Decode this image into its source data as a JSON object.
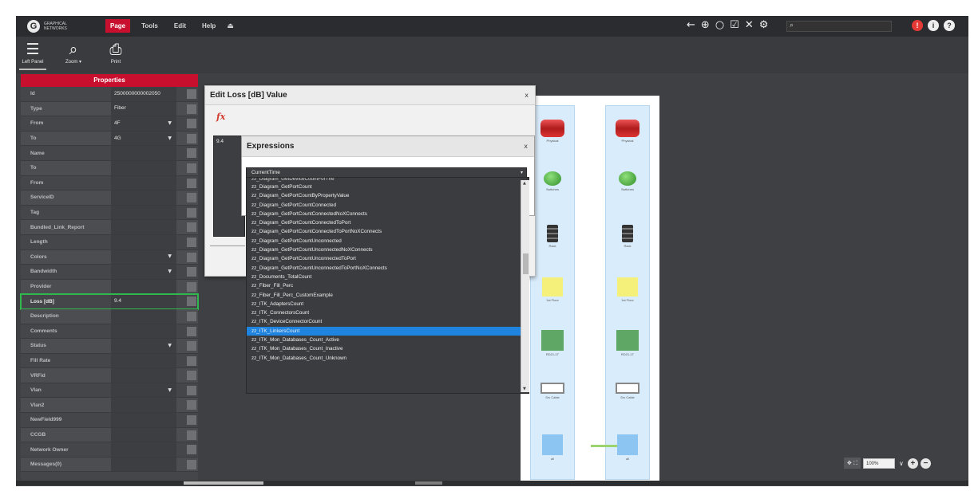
{
  "menubar": {
    "logo_text": "GRAPHICAL NETWORKS",
    "menus": [
      "Page",
      "Tools",
      "Edit",
      "Help"
    ],
    "tool_icons": [
      "back-arrow",
      "globe",
      "circle",
      "checkbox",
      "tools",
      "gear"
    ],
    "search_placeholder": ""
  },
  "ribbon": {
    "buttons": [
      {
        "label": "Left Panel",
        "icon": "left-panel"
      },
      {
        "label": "Zoom ▾",
        "icon": "magnifier"
      },
      {
        "label": "Print",
        "icon": "printer"
      }
    ]
  },
  "properties": {
    "title": "Properties",
    "rows": [
      {
        "name": "Id",
        "value": "2500000000002050"
      },
      {
        "name": "Type",
        "value": "Fiber"
      },
      {
        "name": "From",
        "value": "4F",
        "dropdown": true
      },
      {
        "name": "To",
        "value": "4G",
        "dropdown": true
      },
      {
        "name": "Name",
        "value": ""
      },
      {
        "name": "To",
        "value": ""
      },
      {
        "name": "From",
        "value": ""
      },
      {
        "name": "ServiceID",
        "value": ""
      },
      {
        "name": "Tag",
        "value": ""
      },
      {
        "name": "Bundled_Link_Report",
        "value": ""
      },
      {
        "name": "Length",
        "value": ""
      },
      {
        "name": "Colors",
        "value": "",
        "dropdown": true
      },
      {
        "name": "Bandwidth",
        "value": "",
        "dropdown": true
      },
      {
        "name": "Provider",
        "value": ""
      },
      {
        "name": "Loss [dB]",
        "value": "9.4",
        "highlight": true
      },
      {
        "name": "Description",
        "value": ""
      },
      {
        "name": "Comments",
        "value": ""
      },
      {
        "name": "Status",
        "value": "",
        "dropdown": true
      },
      {
        "name": "Fill Rate",
        "value": ""
      },
      {
        "name": "VRFid",
        "value": ""
      },
      {
        "name": "Vlan",
        "value": "",
        "dropdown": true
      },
      {
        "name": "Vlan2",
        "value": ""
      },
      {
        "name": "NewField999",
        "value": ""
      },
      {
        "name": "CCGB",
        "value": ""
      },
      {
        "name": "Network Owner",
        "value": ""
      },
      {
        "name": "Messages(0)",
        "value": ""
      }
    ]
  },
  "loss_dialog": {
    "title": "Edit Loss [dB] Value",
    "close": "x",
    "fx": "fx",
    "value": "9.4"
  },
  "expressions_dialog": {
    "title": "Expressions",
    "close": "x",
    "selected": "CurrentTime",
    "options": [
      "zz_Diagram_GetDeviceCountForThe",
      "zz_Diagram_GetPortCount",
      "zz_Diagram_GetPortCountByPropertyValue",
      "zz_Diagram_GetPortCountConnected",
      "zz_Diagram_GetPortCountConnectedNoXConnects",
      "zz_Diagram_GetPortCountConnectedToPort",
      "zz_Diagram_GetPortCountConnectedToPortNoXConnects",
      "zz_Diagram_GetPortCountUnconnected",
      "zz_Diagram_GetPortCountUnconnectedNoXConnects",
      "zz_Diagram_GetPortCountUnconnectedToPort",
      "zz_Diagram_GetPortCountUnconnectedToPortNoXConnects",
      "zz_Documents_TotalCount",
      "zz_Fiber_Fill_Perc",
      "zz_Fiber_Fill_Perc_CustomExample",
      "zz_ITK_AdaptersCount",
      "zz_ITK_ConnectorsCount",
      "zz_ITK_DeviceConnectorCount",
      "zz_ITK_LinkersCount",
      "zz_ITK_Mon_Databases_Count_Active",
      "zz_ITK_Mon_Databases_Count_Inactive",
      "zz_ITK_Mon_Databases_Count_Unknown"
    ],
    "selected_index": 17
  },
  "canvas": {
    "nodes": [
      "Physical",
      "Switches",
      "Rack",
      "1st Floor",
      "RD21-1T",
      "Srv Cable",
      "all"
    ]
  },
  "zoom": {
    "value": "100%"
  }
}
